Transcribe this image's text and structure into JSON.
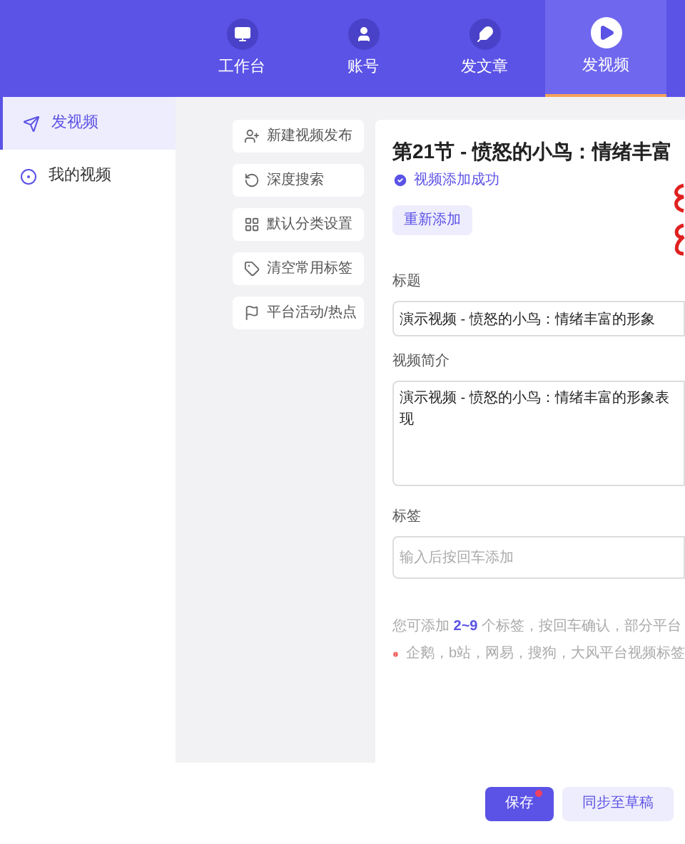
{
  "nav_tabs": [
    {
      "label": "工作台",
      "selected": false
    },
    {
      "label": "账号",
      "selected": false
    },
    {
      "label": "发文章",
      "selected": false
    },
    {
      "label": "发视频",
      "selected": true
    }
  ],
  "sidebar": {
    "items": [
      {
        "label": "发视频",
        "selected": true
      },
      {
        "label": "我的视频",
        "selected": false
      }
    ]
  },
  "actions": [
    {
      "label": "新建视频发布"
    },
    {
      "label": "深度搜索"
    },
    {
      "label": "默认分类设置"
    },
    {
      "label": "清空常用标签"
    },
    {
      "label": "平台活动/热点"
    }
  ],
  "video": {
    "title": "第21节 - 愤怒的小鸟：情绪丰富",
    "status": "视频添加成功",
    "re_add_button": "重新添加"
  },
  "form": {
    "title_label": "标题",
    "title_value": "演示视频 - 愤怒的小鸟：情绪丰富的形象",
    "intro_label": "视频简介",
    "intro_value": "演示视频 - 愤怒的小鸟：情绪丰富的形象表现",
    "tags_label": "标签",
    "tags_placeholder": "输入后按回车添加",
    "hint": "您可添加 **2~9** 个标签，按回车确认，部分平台",
    "warning": "企鹅，b站，网易，搜狗，大风平台视频标签"
  },
  "footer_buttons": [
    {
      "label": "保存",
      "kind": "primary",
      "dot": true
    },
    {
      "label": "同步至草稿",
      "kind": "secondary",
      "dot": false
    }
  ]
}
